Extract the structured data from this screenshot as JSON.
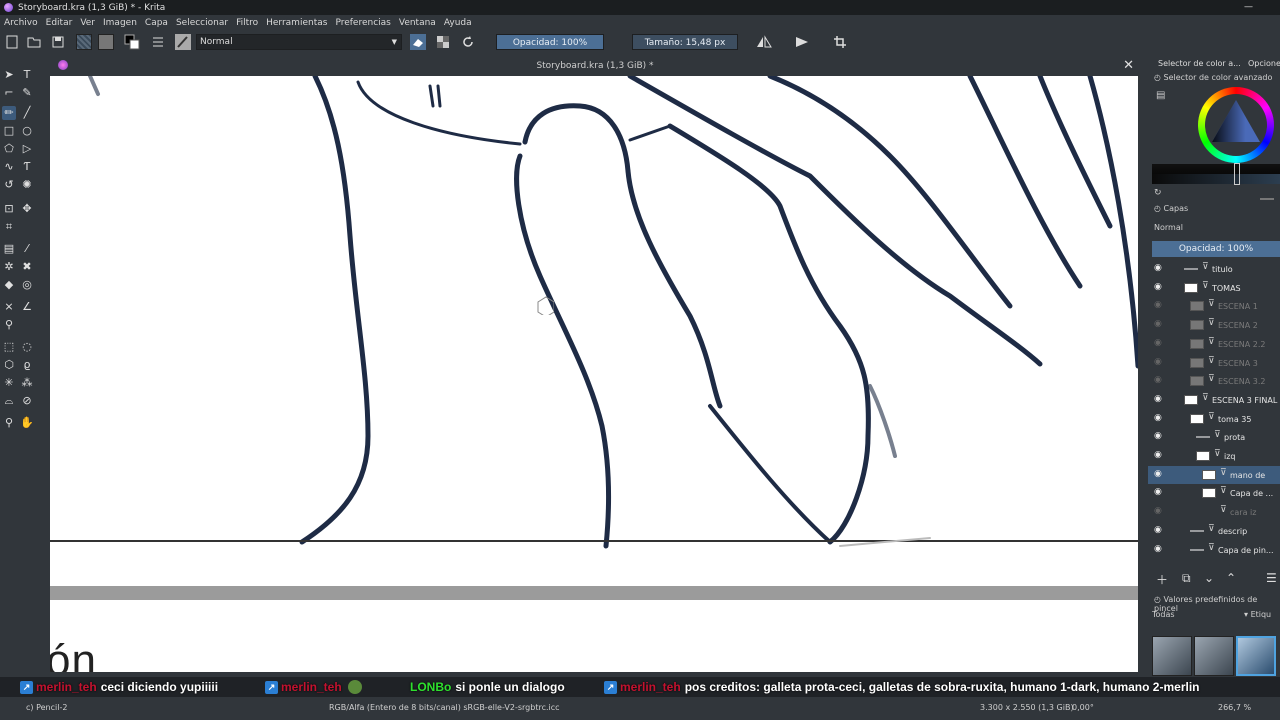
{
  "window": {
    "title": "Storyboard.kra (1,3 GiB) * - Krita",
    "minimize_label": "—"
  },
  "menubar": [
    "Archivo",
    "Editar",
    "Ver",
    "Imagen",
    "Capa",
    "Seleccionar",
    "Filtro",
    "Herramientas",
    "Preferencias",
    "Ventana",
    "Ayuda"
  ],
  "toolbar": {
    "blend_mode": "Normal",
    "opacity": "Opacidad: 100%",
    "size": "Tamaño: 15,48 px"
  },
  "document": {
    "tab_title": "Storyboard.kra (1,3 GiB) *",
    "close_glyph": "✕"
  },
  "canvas": {
    "bottom_text": "ón"
  },
  "dockers": {
    "tab_color": "Selector de color a...",
    "tab_options": "Opcione",
    "color_header": "Selector de color avanzado",
    "layers_header": "Capas",
    "layers_blend": "Normal",
    "layers_opacity": "Opacidad:  100%",
    "presets_header": "Valores predefinidos de pincel",
    "presets_filter": "Todas",
    "presets_tag": "Etiqu"
  },
  "layers": [
    {
      "name": "titulo",
      "visible": true
    },
    {
      "name": "TOMAS",
      "visible": true
    },
    {
      "name": "ESCENA 1",
      "visible": false
    },
    {
      "name": "ESCENA 2",
      "visible": false
    },
    {
      "name": "ESCENA 2.2",
      "visible": false
    },
    {
      "name": "ESCENA 3",
      "visible": false
    },
    {
      "name": "ESCENA 3.2",
      "visible": false
    },
    {
      "name": "ESCENA 3 FINAL",
      "visible": true
    },
    {
      "name": "toma 35",
      "visible": true
    },
    {
      "name": "prota",
      "visible": true
    },
    {
      "name": "izq",
      "visible": true
    },
    {
      "name": "mano de",
      "visible": true,
      "selected": true
    },
    {
      "name": "Capa de ...",
      "visible": true
    },
    {
      "name": "cara iz",
      "visible": false
    },
    {
      "name": "descrip",
      "visible": true
    },
    {
      "name": "Capa de pin...",
      "visible": true
    }
  ],
  "chat": [
    {
      "user": "merlin_teh",
      "text": "ceci diciendo yupiiiii"
    },
    {
      "user": "merlin_teh",
      "text": ""
    },
    {
      "user": "LONBo",
      "text": "si ponle un dialogo"
    },
    {
      "user": "merlin_teh",
      "text": "pos creditos: galleta prota-ceci, galletas de sobra-ruxita, humano 1-dark, humano 2-merlin"
    }
  ],
  "statusbar": {
    "tool": "c) Pencil-2",
    "colorspace": "RGB/Alfa (Entero de 8 bits/canal)  sRGB-elle-V2-srgbtrc.icc",
    "dimensions": "3.300 x 2.550 (1,3 GiB)",
    "rotation": "0,00°",
    "zoom": "266,7 %"
  },
  "colors": {
    "accent": "#4c6f95",
    "selection": "#3d5b7c",
    "ink": "#1e2b45",
    "chat_user": "#c3122f",
    "chat_user_alt": "#2ee02e"
  }
}
